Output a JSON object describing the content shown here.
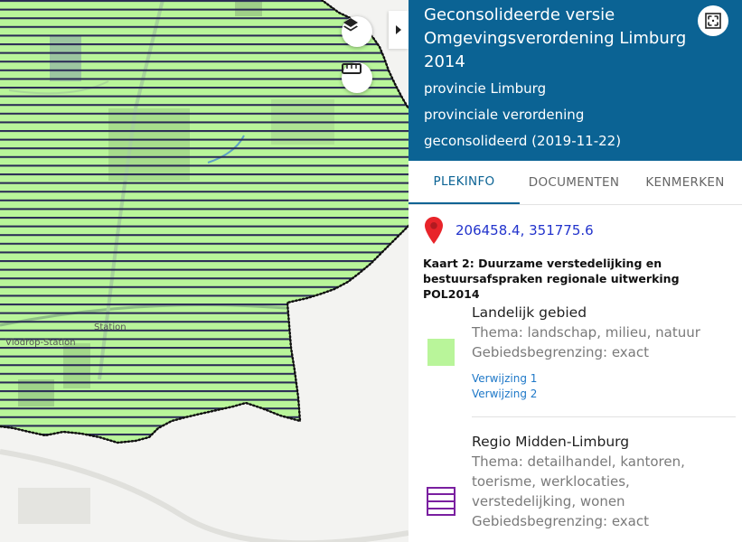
{
  "map": {
    "place_labels": [
      "Station",
      "Vlodrop-Station"
    ],
    "layers_icon": "layers-icon",
    "measure_icon": "ruler-icon",
    "collapse_icon": "chevron-right-icon"
  },
  "panel": {
    "title": "Geconsolideerde versie Omgevingsverordening Limburg 2014",
    "authority": "provincie Limburg",
    "doc_type": "provinciale verordening",
    "status": "geconsolideerd (2019-11-22)",
    "fullscreen_icon": "fullscreen-icon",
    "header_color": "#0b6394"
  },
  "tabs": [
    {
      "label": "PLEKINFO",
      "active": true
    },
    {
      "label": "DOCUMENTEN",
      "active": false
    },
    {
      "label": "KENMERKEN",
      "active": false
    }
  ],
  "location": {
    "coordinates": "206458.4, 351775.6",
    "icon": "map-pin-icon",
    "icon_color": "#e8242a"
  },
  "kaart": {
    "title": "Kaart 2: Duurzame verstedelijking en bestuursafspraken regionale uitwerking POL2014"
  },
  "legend": [
    {
      "name": "Landelijk gebied",
      "details": [
        "Thema: landschap, milieu, natuur",
        "Gebiedsbegrenzing: exact"
      ],
      "links": [
        "Verwijzing 1",
        "Verwijzing 2"
      ],
      "swatch": "solid",
      "color": "#b9f59a"
    },
    {
      "name": "Regio Midden-Limburg",
      "details": [
        "Thema: detailhandel, kantoren,",
        "toerisme, werklocaties,",
        "verstedelijking, wonen",
        "Gebiedsbegrenzing: exact"
      ],
      "links": [],
      "swatch": "hatched",
      "color": "#7a1fa0"
    }
  ]
}
